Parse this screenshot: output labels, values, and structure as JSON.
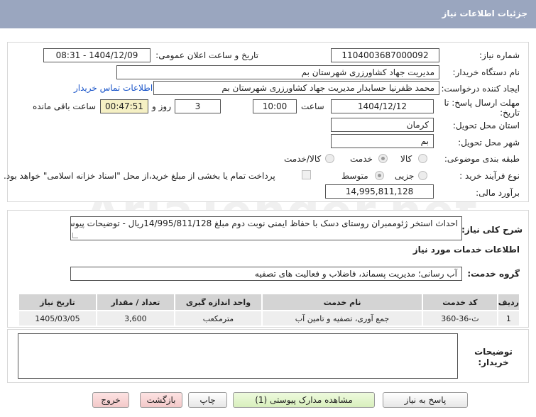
{
  "header": {
    "title": "جزئیات اطلاعات نیاز"
  },
  "form": {
    "need_number_label": "شماره نیاز:",
    "need_number": "1104003687000092",
    "announce_label": "تاریخ و ساعت اعلان عمومی:",
    "announce_value": "1404/12/09 - 08:31",
    "buyer_org_label": "نام دستگاه خریدار:",
    "buyer_org": "مدیریت جهاد کشاورزری شهرستان بم",
    "creator_label": "ایجاد کننده درخواست:",
    "creator": "محمد ظفرنیا حسابدار مدیریت جهاد کشاورزری شهرستان بم",
    "contact_link": "اطلاعات تماس خریدار",
    "deadline_label": "مهلت ارسال پاسخ: تا تاریخ:",
    "deadline_date": "1404/12/12",
    "time_label": "ساعت",
    "deadline_time": "10:00",
    "days_value": "3",
    "days_label": "روز و",
    "remaining_time": "00:47:51",
    "remaining_label": "ساعت باقی مانده",
    "province_label": "استان محل تحویل:",
    "province": "کرمان",
    "city_label": "شهر محل تحویل:",
    "city": "بم",
    "category_label": "طبقه بندی موضوعی:",
    "category_options": [
      "کالا",
      "خدمت",
      "کالا/خدمت"
    ],
    "category_selected": "خدمت",
    "process_label": "نوع فرآیند خرید :",
    "process_options": [
      "جزیی",
      "متوسط"
    ],
    "process_selected": "متوسط",
    "payment_note": "پرداخت تمام یا بخشی از مبلغ خرید،از محل \"اسناد خزانه اسلامی\" خواهد بود.",
    "budget_label": "برآورد مالی:",
    "budget": "14,995,811,128"
  },
  "description": {
    "label": "شرح کلی نیاز:",
    "text": "احداث استخر ژئوممبران روستای دسک با حفاظ ایمنی نوبت دوم مبلغ 14/995/811/128ریال - توضیحات پیوست"
  },
  "services": {
    "section_title": "اطلاعات خدمات مورد نیاز",
    "group_label": "گروه خدمت:",
    "group_value": "آب رسانی؛ مدیریت پسماند، فاضلاب و فعالیت های تصفیه",
    "table": {
      "headers": [
        "ردیف",
        "کد خدمت",
        "نام خدمت",
        "واحد اندازه گیری",
        "تعداد / مقدار",
        "تاریخ نیاز"
      ],
      "rows": [
        [
          "1",
          "ث-36-360",
          "جمع آوری، تصفیه و تامین آب",
          "مترمکعب",
          "3,600",
          "1405/03/05"
        ]
      ]
    }
  },
  "buyer_notes": {
    "label": "توضیحات خریدار:",
    "text": ""
  },
  "buttons": {
    "reply": "پاسخ به نیاز",
    "view_docs": "مشاهده مدارک پیوستی (1)",
    "print": "چاپ",
    "back": "بازگشت",
    "exit": "خروج"
  },
  "watermark": "AriaTender.net"
}
